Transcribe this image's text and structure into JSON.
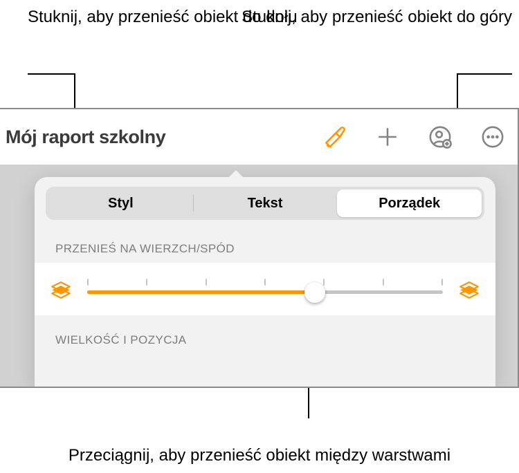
{
  "callouts": {
    "top_left": "Stuknij, aby przenieść obiekt do dołu",
    "top_right": "Stuknij, aby przenieść obiekt do góry",
    "bottom": "Przeciągnij, aby przenieść obiekt między warstwami"
  },
  "toolbar": {
    "title": "Mój raport szkolny"
  },
  "tabs": {
    "style": "Styl",
    "text": "Tekst",
    "arrange": "Porządek",
    "selected": "arrange"
  },
  "sections": {
    "layer_label": "PRZENIEŚ NA WIERZCH/SPÓD",
    "size_label": "WIELKOŚĆ I POZYCJA"
  },
  "slider": {
    "value_percent": 64,
    "tick_count": 7
  },
  "colors": {
    "accent": "#ff9500"
  }
}
